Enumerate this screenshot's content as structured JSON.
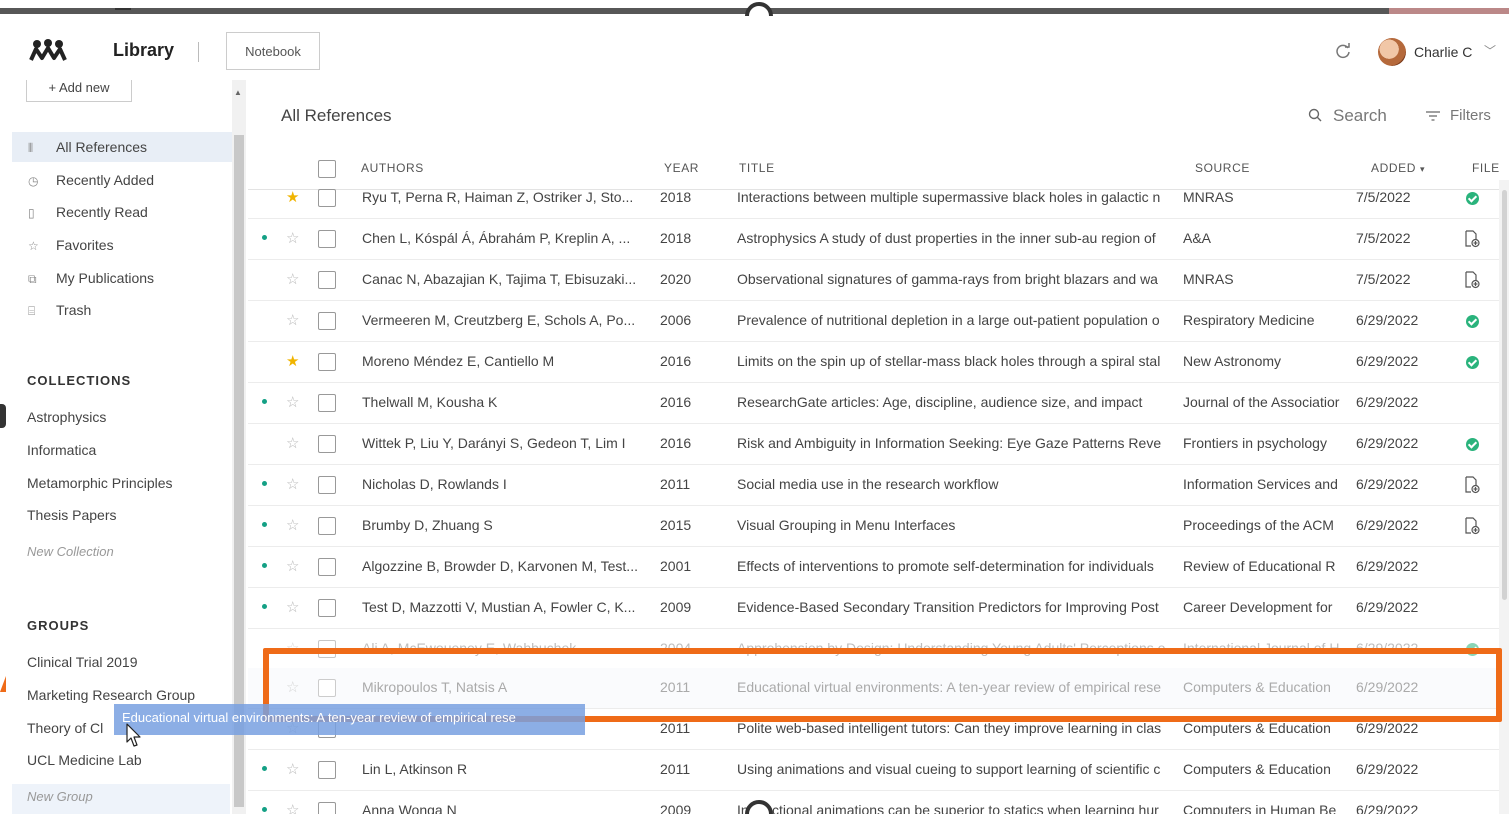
{
  "header": {
    "app_title": "Library",
    "notebook_label": "Notebook",
    "user_name": "Charlie C"
  },
  "sidebar": {
    "add_new_label": "+ Add new",
    "nav": [
      {
        "label": "All References",
        "icon": "library-icon"
      },
      {
        "label": "Recently Added",
        "icon": "clock-icon"
      },
      {
        "label": "Recently Read",
        "icon": "bookmark-icon"
      },
      {
        "label": "Favorites",
        "icon": "star-icon"
      },
      {
        "label": "My Publications",
        "icon": "publication-icon"
      },
      {
        "label": "Trash",
        "icon": "trash-icon"
      }
    ],
    "collections_heading": "COLLECTIONS",
    "collections": [
      "Astrophysics",
      "Informatica",
      "Metamorphic Principles",
      "Thesis Papers"
    ],
    "new_collection": "New Collection",
    "groups_heading": "GROUPS",
    "groups": [
      "Clinical Trial 2019",
      "Marketing Research Group",
      "Theory of Cl",
      "UCL Medicine Lab"
    ],
    "new_group": "New Group"
  },
  "main": {
    "title": "All References",
    "search_label": "Search",
    "filters_label": "Filters",
    "columns": {
      "authors": "AUTHORS",
      "year": "YEAR",
      "title": "TITLE",
      "source": "SOURCE",
      "added": "ADDED",
      "file": "FILE"
    },
    "sort_indicator": "▾",
    "rows": [
      {
        "authors": "Ryu T, Perna R, Haiman Z, Ostriker J, Sto...",
        "year": "2018",
        "title": "Interactions between multiple supermassive black holes in galactic n",
        "source": "MNRAS",
        "added": "7/5/2022"
      },
      {
        "authors": "Chen L, Kóspál Á, Ábrahám P, Kreplin A, ...",
        "year": "2018",
        "title": "Astrophysics A study of dust properties in the inner sub-au region of",
        "source": "A&A",
        "added": "7/5/2022"
      },
      {
        "authors": "Canac N, Abazajian K, Tajima T, Ebisuzaki...",
        "year": "2020",
        "title": "Observational signatures of gamma-rays from bright blazars and wa",
        "source": "MNRAS",
        "added": "7/5/2022"
      },
      {
        "authors": "Vermeeren M, Creutzberg E, Schols A, Po...",
        "year": "2006",
        "title": "Prevalence of nutritional depletion in a large out-patient population o",
        "source": "Respiratory Medicine",
        "added": "6/29/2022"
      },
      {
        "authors": "Moreno Méndez E, Cantiello M",
        "year": "2016",
        "title": "Limits on the spin up of stellar-mass black holes through a spiral stal",
        "source": "New Astronomy",
        "added": "6/29/2022"
      },
      {
        "authors": "Thelwall M, Kousha K",
        "year": "2016",
        "title": "ResearchGate articles: Age, discipline, audience size, and impact",
        "source": "Journal of the Associatior",
        "added": "6/29/2022"
      },
      {
        "authors": "Wittek P, Liu Y, Darányi S, Gedeon T, Lim I",
        "year": "2016",
        "title": "Risk and Ambiguity in Information Seeking: Eye Gaze Patterns Reve",
        "source": "Frontiers in psychology",
        "added": "6/29/2022"
      },
      {
        "authors": "Nicholas D, Rowlands I",
        "year": "2011",
        "title": "Social media use in the research workflow",
        "source": "Information Services and",
        "added": "6/29/2022"
      },
      {
        "authors": "Brumby D, Zhuang S",
        "year": "2015",
        "title": "Visual Grouping in Menu Interfaces",
        "source": "Proceedings of the ACM",
        "added": "6/29/2022"
      },
      {
        "authors": "Algozzine B, Browder D, Karvonen M, Test...",
        "year": "2001",
        "title": "Effects of interventions to promote self-determination for individuals",
        "source": "Review of Educational R",
        "added": "6/29/2022"
      },
      {
        "authors": "Test D, Mazzotti V, Mustian A, Fowler C, K...",
        "year": "2009",
        "title": "Evidence-Based Secondary Transition Predictors for Improving Post",
        "source": "Career Development for",
        "added": "6/29/2022"
      },
      {
        "authors": "Ali A, McEwoueney E, Wahbuchek...",
        "year": "2004",
        "title": "Apprehension by Design: Understanding Young Adults' Perceptions o",
        "source": "International Journal of H",
        "added": "6/29/2022"
      },
      {
        "authors": "Mikropoulos T, Natsis A",
        "year": "2011",
        "title": "Educational virtual environments: A ten-year review of empirical rese",
        "source": "Computers & Education",
        "added": "6/29/2022"
      },
      {
        "authors": "",
        "year": "2011",
        "title": "Polite web-based intelligent tutors: Can they improve learning in clas",
        "source": "Computers & Education",
        "added": "6/29/2022"
      },
      {
        "authors": "Lin L, Atkinson R",
        "year": "2011",
        "title": "Using animations and visual cueing to support learning of scientific c",
        "source": "Computers & Education",
        "added": "6/29/2022"
      },
      {
        "authors": "Anna Wonga N",
        "year": "2009",
        "title": "Instructional animations can be superior to statics when learning hur",
        "source": "Computers in Human Be",
        "added": "6/29/2022"
      }
    ]
  },
  "drag_tooltip": "Educational virtual environments: A ten-year review of empirical rese",
  "colors": {
    "accent_orange": "#ef6b18",
    "file_ok_green": "#2ab37c",
    "unread_dot": "#14a085",
    "favorite_star": "#f0b400",
    "active_nav_bg": "#e8eef6",
    "drag_tooltip_bg": "#78a0e1"
  }
}
